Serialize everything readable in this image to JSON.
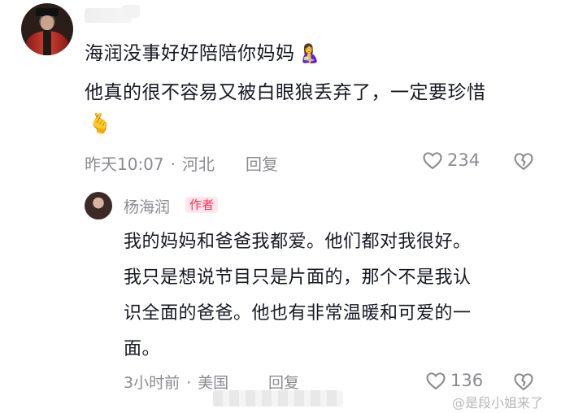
{
  "comment": {
    "text_line1": "海润没事好好陪陪你妈妈",
    "text_line2": "他真的很不容易又被白眼狼丢弃了，一定要珍惜",
    "emoji_line1": "🤱",
    "emoji_line2": "🫰",
    "time": "昨天10:07",
    "location": "河北",
    "reply_label": "回复",
    "likes": "234"
  },
  "reply": {
    "author": "杨海润",
    "author_tag": "作者",
    "lines": [
      "我的妈妈和爸爸我都爱。他们都对我很好。",
      "我只是想说节目只是片面的，那个不是我认",
      "识全面的爸爸。他也有非常温暖和可爱的一",
      "面。"
    ],
    "time": "3小时前",
    "location": "美国",
    "reply_label": "回复",
    "likes": "136"
  },
  "watermark": "@是段小姐来了",
  "colors": {
    "text": "#161823",
    "meta": "#8a8b91",
    "tag": "#fe2c55",
    "tag_bg": "#ffe7ec"
  },
  "icons": [
    "heart-outline-icon",
    "broken-heart-icon"
  ]
}
